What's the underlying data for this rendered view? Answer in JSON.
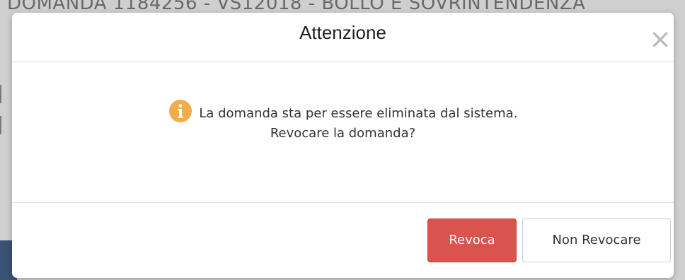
{
  "background": {
    "partial_text": "DOMANDA 1184256 - VS12018 - BOLLO E SOVRINTENDENZA"
  },
  "modal": {
    "title": "Attenzione",
    "close_label": "×",
    "message_line1": "La domanda sta per essere eliminata dal sistema.",
    "message_line2": "Revocare la domanda?",
    "icon": "info-icon",
    "buttons": {
      "revoke_label": "Revoca",
      "dont_revoke_label": "Non Revocare"
    }
  },
  "colors": {
    "info_icon": "#f0ad4e",
    "danger_button": "#d9534f",
    "title": "#1f1f1f",
    "text": "#333333"
  }
}
